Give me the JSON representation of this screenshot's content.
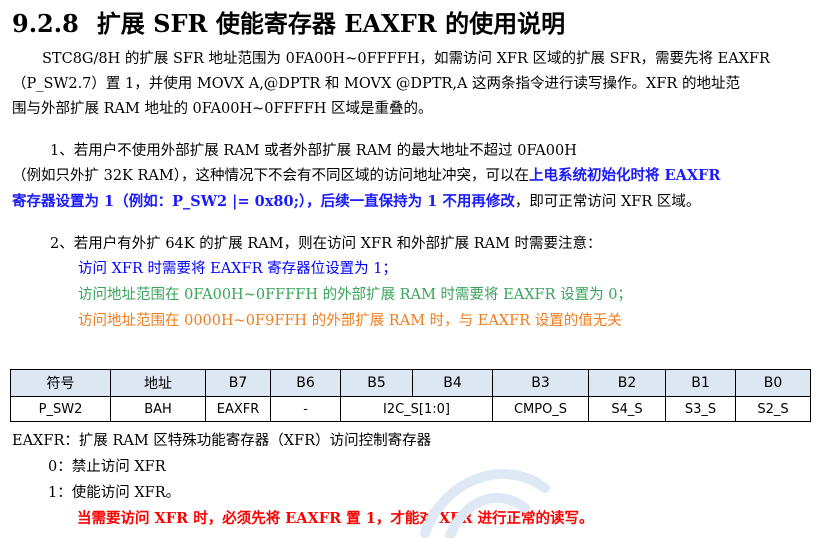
{
  "section": {
    "number": "9.2.8",
    "title": "扩展 SFR 使能寄存器 EAXFR 的使用说明"
  },
  "intro": {
    "line1": "STC8G/8H 的扩展 SFR 地址范围为 0FA00H~0FFFFH，如需访问 XFR 区域的扩展 SFR，需要先将 EAXFR",
    "line2": "（P_SW2.7）置 1，并使用 MOVX A,@DPTR 和 MOVX @DPTR,A 这两条指令进行读写操作。XFR 的地址范",
    "line3": "围与外部扩展 RAM 地址的 0FA00H~0FFFFH 区域是重叠的。"
  },
  "case1": {
    "line1": "1、若用户不使用外部扩展 RAM 或者外部扩展 RAM 的最大地址不超过 0FA00H",
    "line2_plain": "（例如只外扩 32K RAM），这种情况下不会有不同区域的访问地址冲突，可以在",
    "line2_hl": "上电系统初始化时将 EAXFR",
    "line3_hl": "寄存器设置为 1（例如：P_SW2 |= 0x80;），后续一直保持为 1 不用再修改",
    "line3_plain": "，即可正常访问 XFR 区域。"
  },
  "case2": {
    "line1": "2、若用户有外扩 64K 的扩展 RAM，则在访问 XFR 和外部扩展 RAM 时需要注意：",
    "note_blue": "访问 XFR 时需要将 EAXFR 寄存器位设置为 1；",
    "note_green": "访问地址范围在 0FA00H~0FFFFH 的外部扩展 RAM 时需要将 EAXFR 设置为 0；",
    "note_orange": "访问地址范围在 0000H~0F9FFH 的外部扩展 RAM 时，与 EAXFR 设置的值无关"
  },
  "register_table": {
    "headers": [
      "符号",
      "地址",
      "B7",
      "B6",
      "B5",
      "B4",
      "B3",
      "B2",
      "B1",
      "B0"
    ],
    "row": {
      "symbol": "P_SW2",
      "address": "BAH",
      "b7": "EAXFR",
      "b6": "-",
      "b5_b4": "I2C_S[1:0]",
      "b3": "CMPO_S",
      "b2": "S4_S",
      "b1": "S3_S",
      "b0": "S2_S"
    }
  },
  "description": {
    "title": "EAXFR：扩展 RAM 区特殊功能寄存器（XFR）访问控制寄存器",
    "opt0": "0：禁止访问 XFR",
    "opt1": "1：使能访问 XFR。",
    "warning": "当需要访问 XFR 时，必须先将 EAXFR 置 1，才能对 XFR 进行正常的读写。"
  },
  "colors": {
    "highlight_blue": "#1a1aff",
    "note_blue": "#0000ff",
    "note_green": "#3aa35a",
    "note_orange": "#f07c1e",
    "warning_red": "#ff0000",
    "table_header_bg": "#dde6f3"
  }
}
